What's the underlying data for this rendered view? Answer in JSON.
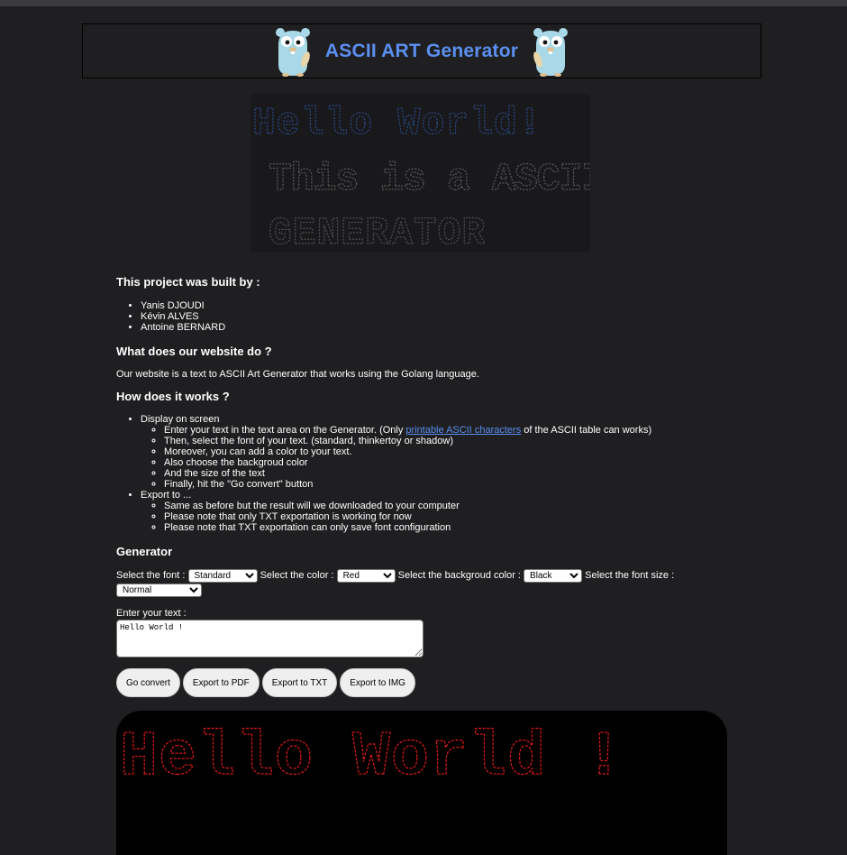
{
  "header": {
    "title": "ASCII ART Generator",
    "gopher_icon": "gopher-mascot-icon",
    "title_color": "#5b8ff0"
  },
  "banner": {
    "lines": [
      "Hello World!",
      "This is a ASCII",
      "GENERATOR"
    ]
  },
  "credits": {
    "heading": "This project was built by :",
    "authors": [
      "Yanis DJOUDI",
      "Kévin ALVES",
      "Antoine BERNARD"
    ]
  },
  "about": {
    "heading": "What does our website do ?",
    "text": "Our website is a text to ASCII Art Generator that works using the Golang language."
  },
  "howto": {
    "heading": "How does it works ?",
    "display_label": "Display on screen",
    "display_steps": {
      "s1_before": "Enter your text in the text area on the Generator. (Only ",
      "s1_link": "printable ASCII characters",
      "s1_after": " of the ASCII table can works)",
      "s2": "Then, select the font of your text. (standard, thinkertoy or shadow)",
      "s3": "Moreover, you can add a color to your text.",
      "s4": "Also choose the backgroud color",
      "s5": "And the size of the text",
      "s6": "Finally, hit the \"Go convert\" button"
    },
    "export_label": "Export to ...",
    "export_steps": [
      "Same as before but the result will we downloaded to your computer",
      "Please note that only TXT exportation is working for now",
      "Please note that TXT exportation can only save font configuration"
    ]
  },
  "generator": {
    "heading": "Generator",
    "font_label": "Select the font :",
    "font_value": "Standard",
    "color_label": "Select the color :",
    "color_value": "Red",
    "bg_label": "Select the backgroud color :",
    "bg_value": "Black",
    "size_label": "Select the font size :",
    "size_value": "Normal",
    "text_label": "Enter your text :",
    "text_value": "Hello World !",
    "buttons": {
      "convert": "Go convert",
      "pdf": "Export to PDF",
      "txt": "Export to TXT",
      "img": "Export to IMG"
    }
  },
  "output": {
    "text": "Hello World !",
    "color": "#d81818",
    "background": "#000000"
  }
}
